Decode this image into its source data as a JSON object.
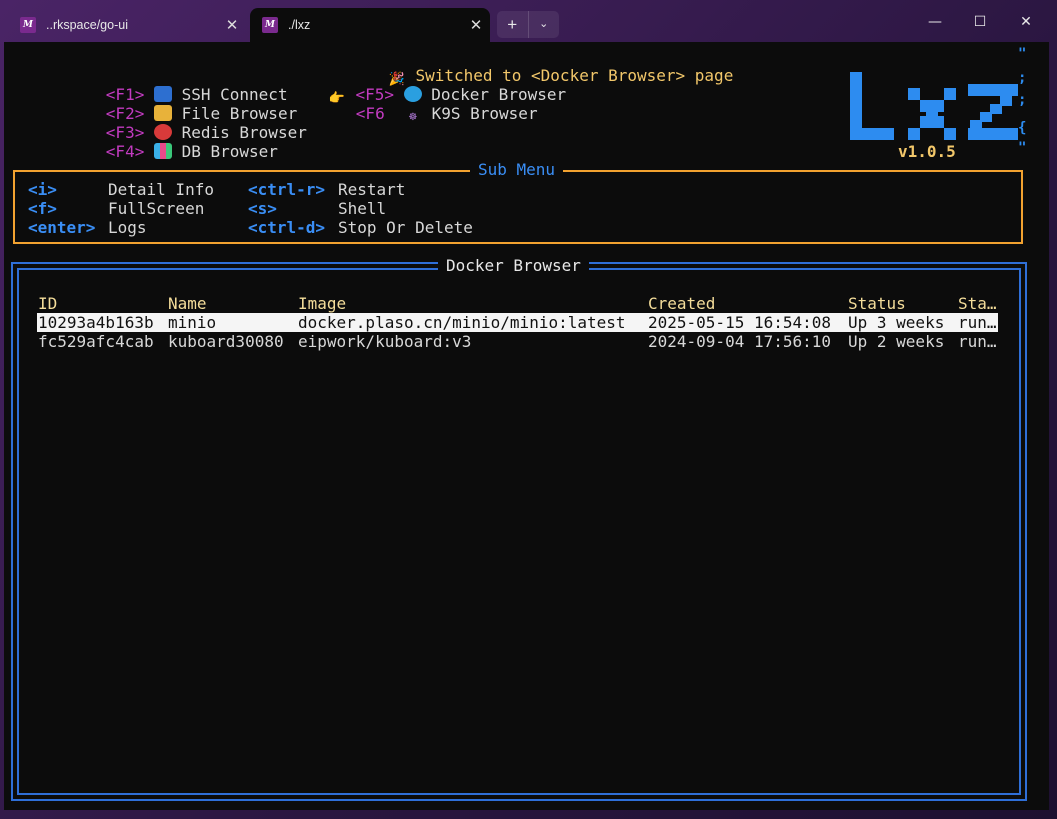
{
  "window": {
    "tabs": [
      {
        "title": "..rkspace/go-ui",
        "icon_label": "M",
        "active": false
      },
      {
        "title": "./lxz",
        "icon_label": "M",
        "active": true
      }
    ],
    "controls": {
      "minimize": "—",
      "maximize": "☐",
      "close": "✕"
    }
  },
  "notice": {
    "text": "Switched to <Docker Browser> page",
    "icon": "party-popper-icon"
  },
  "main_menu": [
    {
      "key": "<F1>",
      "icon": "computer-icon",
      "label": "SSH Connect",
      "pointer": false
    },
    {
      "key": "<F2>",
      "icon": "folder-icon",
      "label": "File Browser",
      "pointer": false
    },
    {
      "key": "<F3>",
      "icon": "target-icon",
      "label": "Redis Browser",
      "pointer": false
    },
    {
      "key": "<F4>",
      "icon": "bar-chart-icon",
      "label": "DB Browser",
      "pointer": false
    },
    {
      "key": "<F5>",
      "icon": "whale-icon",
      "label": "Docker Browser",
      "pointer": true
    },
    {
      "key": "<F6",
      "icon": "helm-icon",
      "label": "K9S Browser",
      "pointer": false
    }
  ],
  "logo": {
    "text": "LXZ",
    "version": "v1.0.5",
    "side_glyphs": [
      "\"",
      ";",
      ";",
      "{",
      "\""
    ]
  },
  "sub_menu": {
    "title": "Sub Menu",
    "items": [
      {
        "key": "<i>",
        "label": "Detail Info"
      },
      {
        "key": "<f>",
        "label": "FullScreen"
      },
      {
        "key": "<enter>",
        "label": "Logs"
      },
      {
        "key": "<ctrl-r>",
        "label": "Restart"
      },
      {
        "key": "<s>",
        "label": "Shell"
      },
      {
        "key": "<ctrl-d>",
        "label": "Stop Or Delete"
      }
    ]
  },
  "docker_browser": {
    "title": "Docker Browser",
    "columns": [
      "ID",
      "Name",
      "Image",
      "Created",
      "Status",
      "Sta…"
    ],
    "rows": [
      [
        "10293a4b163b",
        "minio",
        "docker.plaso.cn/minio/minio:latest",
        "2025-05-15 16:54:08",
        "Up 3 weeks",
        "run…"
      ],
      [
        "fc529afc4cab",
        "kuboard30080",
        "eipwork/kuboard:v3",
        "2024-09-04 17:56:10",
        "Up 2 weeks",
        "run…"
      ]
    ],
    "selected_row": 0
  },
  "colors": {
    "key": "#c23bc0",
    "notice": "#f2c76a",
    "accent_blue": "#3a8ef5",
    "submenu_border": "#f2a230",
    "panel_border": "#2f6fd8",
    "header": "#f4dd9a"
  }
}
